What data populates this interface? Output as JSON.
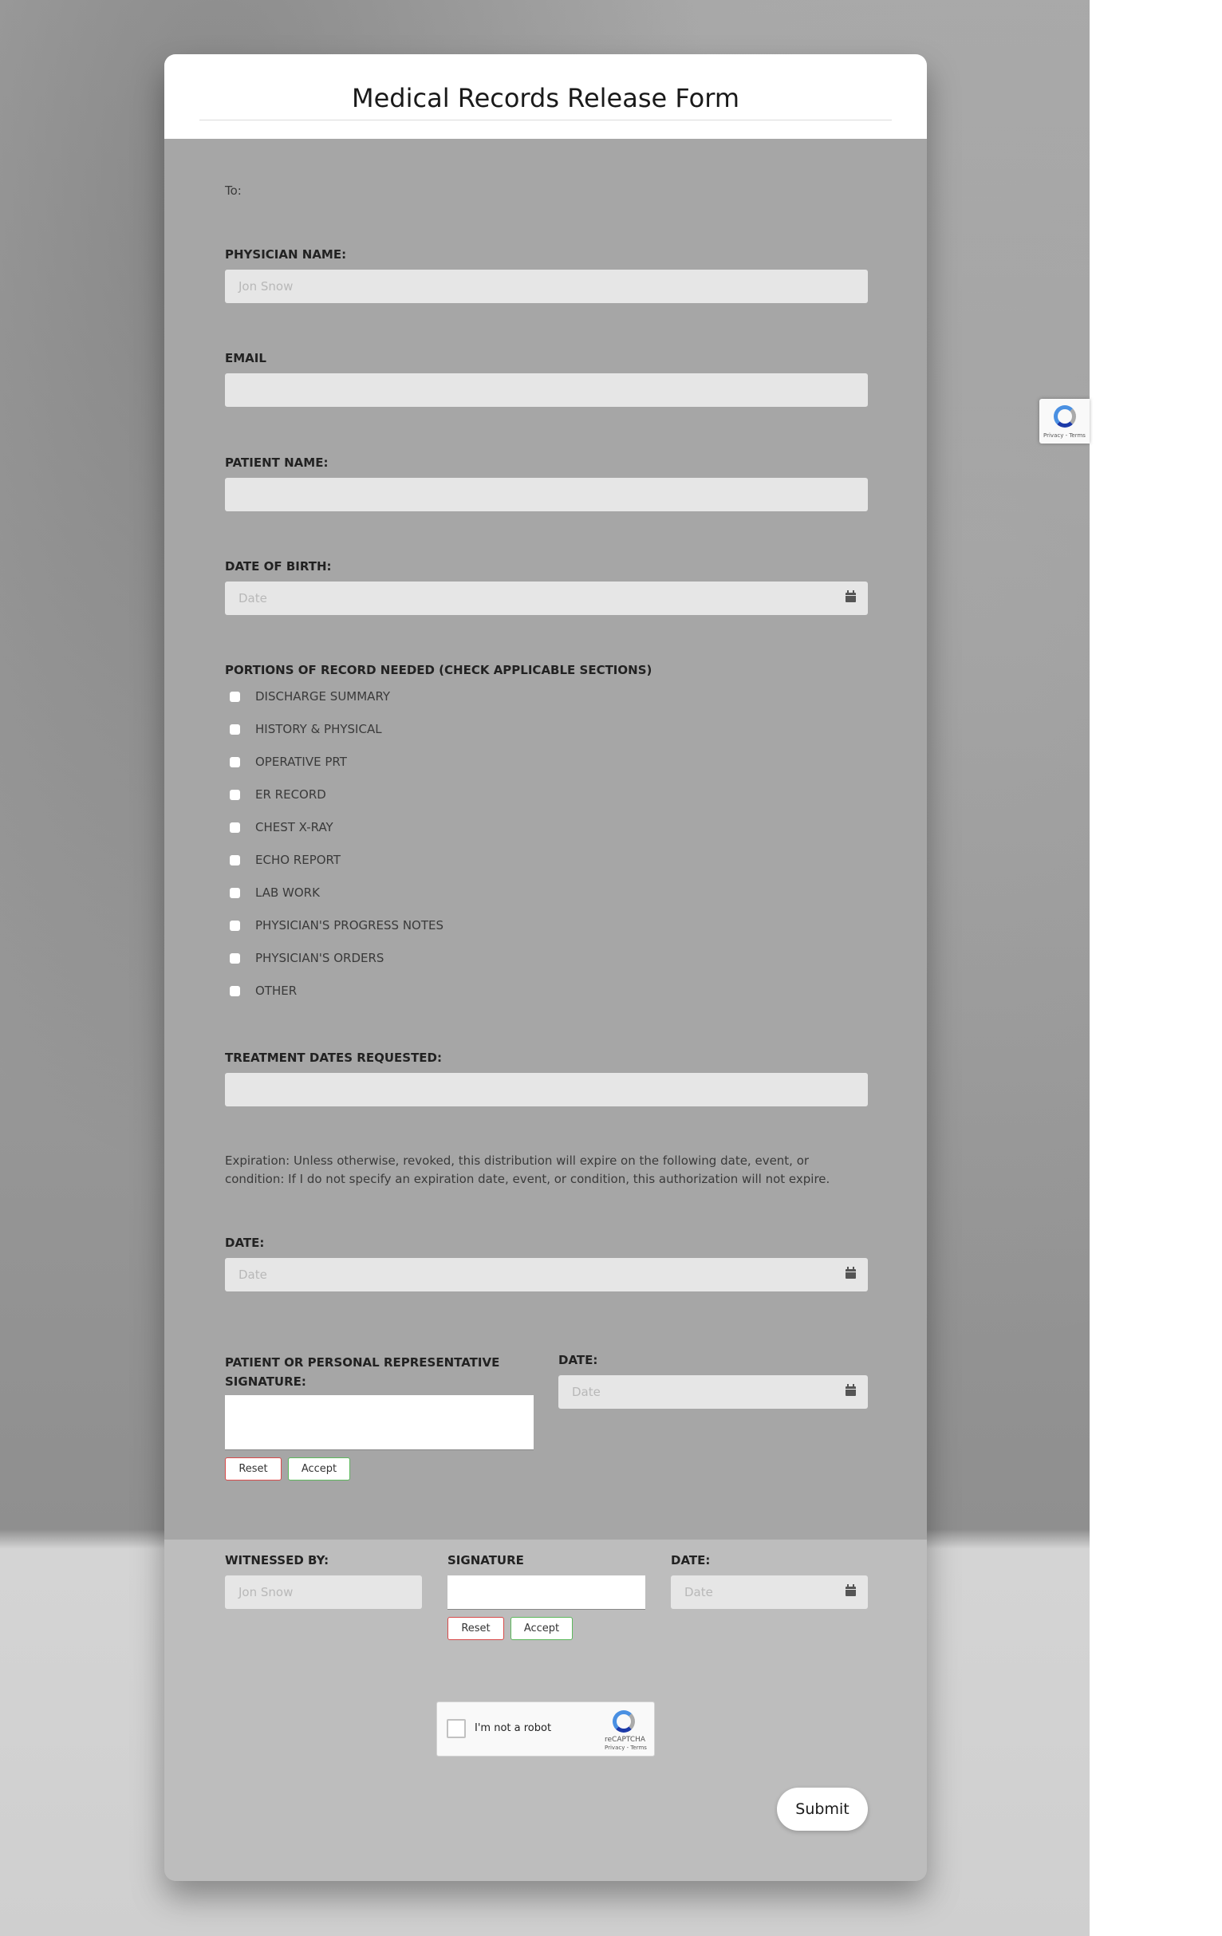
{
  "form": {
    "title": "Medical Records Release Form",
    "to_label": "To:",
    "physician": {
      "label": "PHYSICIAN NAME:",
      "placeholder": "Jon Snow"
    },
    "email": {
      "label": "EMAIL",
      "placeholder": ""
    },
    "patient": {
      "label": "PATIENT NAME:",
      "placeholder": ""
    },
    "dob": {
      "label": "DATE OF BIRTH:",
      "placeholder": "Date"
    },
    "portions": {
      "label": "PORTIONS OF RECORD NEEDED (CHECK APPLICABLE SECTIONS)",
      "options": [
        "DISCHARGE SUMMARY",
        "HISTORY & PHYSICAL",
        "OPERATIVE PRT",
        "ER RECORD",
        "CHEST X-RAY",
        "ECHO REPORT",
        "LAB WORK",
        "PHYSICIAN'S PROGRESS NOTES",
        "PHYSICIAN'S ORDERS",
        "OTHER"
      ]
    },
    "treatment_dates": {
      "label": "TREATMENT DATES REQUESTED:",
      "placeholder": ""
    },
    "expiration_text": "Expiration: Unless otherwise, revoked, this distribution will expire on the following date, event, or condition: If I do not specify an expiration date, event, or condition, this authorization will not expire.",
    "exp_date": {
      "label": "DATE:",
      "placeholder": "Date"
    },
    "patient_signature": {
      "label": "PATIENT OR PERSONAL REPRESENTATIVE SIGNATURE:",
      "reset": "Reset",
      "accept": "Accept"
    },
    "sig_date": {
      "label": "DATE:",
      "placeholder": "Date"
    },
    "witnessed": {
      "label": "WITNESSED BY:",
      "placeholder": "Jon Snow"
    },
    "witness_signature": {
      "label": "SIGNATURE",
      "reset": "Reset",
      "accept": "Accept"
    },
    "witness_date": {
      "label": "DATE:",
      "placeholder": "Date"
    },
    "captcha": {
      "text": "I'm not a robot",
      "brand": "reCAPTCHA",
      "terms": "Privacy - Terms"
    },
    "submit_label": "Submit"
  },
  "recaptcha_badge": {
    "terms": "Privacy - Terms"
  }
}
